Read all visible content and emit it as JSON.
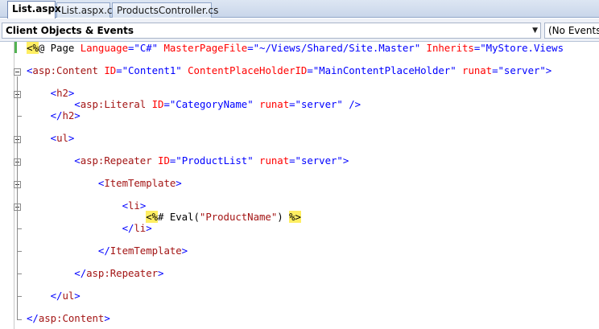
{
  "tabs": [
    {
      "label": "List.aspx",
      "active": true
    },
    {
      "label": "List.aspx.cs",
      "active": false
    },
    {
      "label": "ProductsController.cs",
      "active": false
    }
  ],
  "dropdowns": {
    "objects": "Client Objects & Events",
    "events": "(No Events)"
  },
  "code_lines": [
    [
      [
        "hl",
        "<%"
      ],
      [
        "tk-txt",
        "@ Page "
      ],
      [
        "tk-attr",
        "Language"
      ],
      [
        "tk-br",
        "="
      ],
      [
        "tk-val",
        "\"C#\""
      ],
      [
        "tk-txt",
        " "
      ],
      [
        "tk-attr",
        "MasterPageFile"
      ],
      [
        "tk-br",
        "="
      ],
      [
        "tk-val",
        "\"~/Views/Shared/Site.Master\""
      ],
      [
        "tk-txt",
        " "
      ],
      [
        "tk-attr",
        "Inherits"
      ],
      [
        "tk-br",
        "="
      ],
      [
        "tk-val",
        "\"MyStore.Views"
      ]
    ],
    [
      [
        "tk-br",
        "<"
      ],
      [
        "tk-tag",
        "asp:Content"
      ],
      [
        "tk-txt",
        " "
      ],
      [
        "tk-attr",
        "ID"
      ],
      [
        "tk-br",
        "="
      ],
      [
        "tk-val",
        "\"Content1\""
      ],
      [
        "tk-txt",
        " "
      ],
      [
        "tk-attr",
        "ContentPlaceHolderID"
      ],
      [
        "tk-br",
        "="
      ],
      [
        "tk-val",
        "\"MainContentPlaceHolder\""
      ],
      [
        "tk-txt",
        " "
      ],
      [
        "tk-attr",
        "runat"
      ],
      [
        "tk-br",
        "="
      ],
      [
        "tk-val",
        "\"server\""
      ],
      [
        "tk-br",
        ">"
      ]
    ],
    [
      [
        "tk-txt",
        "    "
      ],
      [
        "tk-br",
        "<"
      ],
      [
        "tk-tag",
        "h2"
      ],
      [
        "tk-br",
        ">"
      ]
    ],
    [
      [
        "tk-txt",
        "        "
      ],
      [
        "tk-br",
        "<"
      ],
      [
        "tk-tag",
        "asp:Literal"
      ],
      [
        "tk-txt",
        " "
      ],
      [
        "tk-attr",
        "ID"
      ],
      [
        "tk-br",
        "="
      ],
      [
        "tk-val",
        "\"CategoryName\""
      ],
      [
        "tk-txt",
        " "
      ],
      [
        "tk-attr",
        "runat"
      ],
      [
        "tk-br",
        "="
      ],
      [
        "tk-val",
        "\"server\""
      ],
      [
        "tk-txt",
        " "
      ],
      [
        "tk-br",
        "/>"
      ]
    ],
    [
      [
        "tk-txt",
        "    "
      ],
      [
        "tk-br",
        "</"
      ],
      [
        "tk-tag",
        "h2"
      ],
      [
        "tk-br",
        ">"
      ]
    ],
    [
      [
        "tk-txt",
        "    "
      ],
      [
        "tk-br",
        "<"
      ],
      [
        "tk-tag",
        "ul"
      ],
      [
        "tk-br",
        ">"
      ]
    ],
    [
      [
        "tk-txt",
        "        "
      ],
      [
        "tk-br",
        "<"
      ],
      [
        "tk-tag",
        "asp:Repeater"
      ],
      [
        "tk-txt",
        " "
      ],
      [
        "tk-attr",
        "ID"
      ],
      [
        "tk-br",
        "="
      ],
      [
        "tk-val",
        "\"ProductList\""
      ],
      [
        "tk-txt",
        " "
      ],
      [
        "tk-attr",
        "runat"
      ],
      [
        "tk-br",
        "="
      ],
      [
        "tk-val",
        "\"server\""
      ],
      [
        "tk-br",
        ">"
      ]
    ],
    [
      [
        "tk-txt",
        "            "
      ],
      [
        "tk-br",
        "<"
      ],
      [
        "tk-tag",
        "ItemTemplate"
      ],
      [
        "tk-br",
        ">"
      ]
    ],
    [
      [
        "tk-txt",
        "                "
      ],
      [
        "tk-br",
        "<"
      ],
      [
        "tk-tag",
        "li"
      ],
      [
        "tk-br",
        ">"
      ]
    ],
    [
      [
        "tk-txt",
        "                    "
      ],
      [
        "hl",
        "<%"
      ],
      [
        "tk-txt",
        "# Eval("
      ],
      [
        "tk-str",
        "\"ProductName\""
      ],
      [
        "tk-txt",
        ") "
      ],
      [
        "hl",
        "%>"
      ]
    ],
    [
      [
        "tk-txt",
        "                "
      ],
      [
        "tk-br",
        "</"
      ],
      [
        "tk-tag",
        "li"
      ],
      [
        "tk-br",
        ">"
      ]
    ],
    [
      [
        "tk-txt",
        "            "
      ],
      [
        "tk-br",
        "</"
      ],
      [
        "tk-tag",
        "ItemTemplate"
      ],
      [
        "tk-br",
        ">"
      ]
    ],
    [
      [
        "tk-txt",
        "        "
      ],
      [
        "tk-br",
        "</"
      ],
      [
        "tk-tag",
        "asp:Repeater"
      ],
      [
        "tk-br",
        ">"
      ]
    ],
    [
      [
        "tk-txt",
        "    "
      ],
      [
        "tk-br",
        "</"
      ],
      [
        "tk-tag",
        "ul"
      ],
      [
        "tk-br",
        ">"
      ]
    ],
    [
      [
        "tk-br",
        "</"
      ],
      [
        "tk-tag",
        "asp:Content"
      ],
      [
        "tk-br",
        ">"
      ]
    ]
  ]
}
